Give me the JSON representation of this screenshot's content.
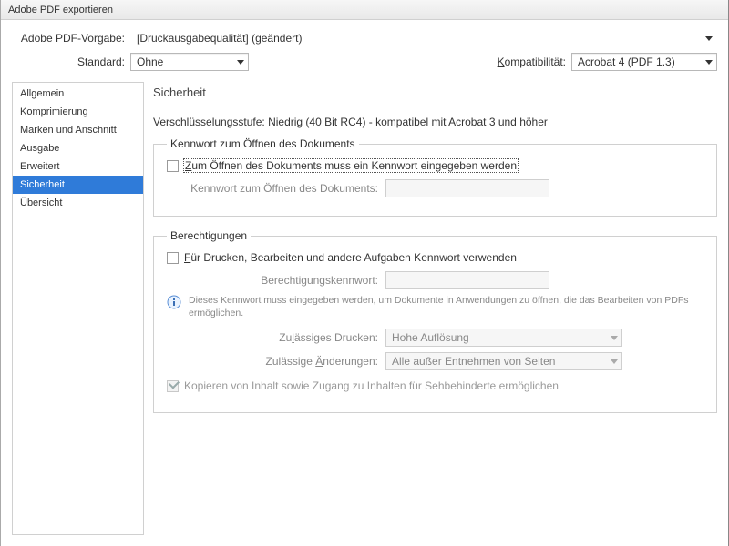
{
  "title": "Adobe PDF exportieren",
  "top": {
    "presetLabel": "Adobe PDF-Vorgabe:",
    "presetValue": "[Druckausgabequalität] (geändert)",
    "standardLabel": "Standard:",
    "standardValue": "Ohne",
    "compatLabelPrefix": "K",
    "compatLabelRest": "ompatibilität:",
    "compatValue": "Acrobat 4 (PDF 1.3)"
  },
  "sidebar": {
    "items": [
      "Allgemein",
      "Komprimierung",
      "Marken und Anschnitt",
      "Ausgabe",
      "Erweitert",
      "Sicherheit",
      "Übersicht"
    ],
    "selectedIndex": 5
  },
  "panel": {
    "title": "Sicherheit",
    "encLevel": "Verschlüsselungsstufe: Niedrig (40 Bit RC4) - kompatibel mit Acrobat 3 und höher",
    "openGroup": {
      "legend": "Kennwort zum Öffnen des Dokuments",
      "cbPrefix": "Z",
      "cbRest": "um Öffnen des Dokuments muss ein Kennwort eingegeben werden",
      "pwLabel": "Kennwort zum Öffnen des Dokuments:"
    },
    "permGroup": {
      "legend": "Berechtigungen",
      "cbPrefix": "F",
      "cbRest": "ür Drucken, Bearbeiten und andere Aufgaben Kennwort verwenden",
      "pwLabel": "Berechtigungskennwort:",
      "infoText": "Dieses Kennwort muss eingegeben werden, um Dokumente in Anwendungen zu öffnen, die das Bearbeiten von PDFs ermöglichen.",
      "printLabelPre": "Zu",
      "printLabelU": "l",
      "printLabelPost": "ässiges Drucken:",
      "printValue": "Hohe Auflösung",
      "changesLabelPre": "Zulässige ",
      "changesLabelU": "Ä",
      "changesLabelPost": "nderungen:",
      "changesValue": "Alle außer Entnehmen von Seiten",
      "copyCb": "Kopieren von Inhalt sowie Zugang zu Inhalten für Sehbehinderte ermöglichen"
    }
  }
}
